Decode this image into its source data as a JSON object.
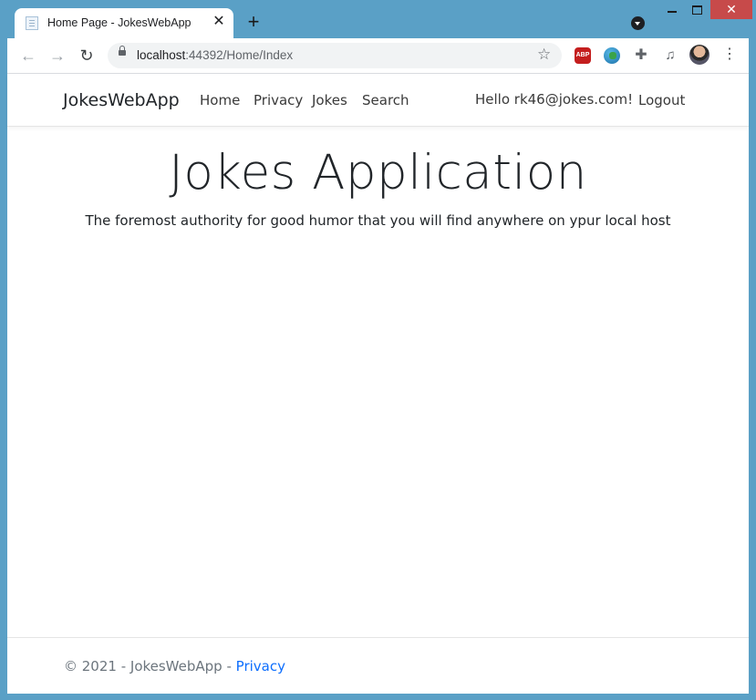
{
  "browser": {
    "tab_title": "Home Page - JokesWebApp",
    "url_host": "localhost",
    "url_path": ":44392/Home/Index"
  },
  "site": {
    "brand": "JokesWebApp",
    "nav": {
      "home": "Home",
      "privacy": "Privacy",
      "jokes": "Jokes",
      "search": "Search"
    },
    "hello": "Hello rk46@jokes.com!",
    "logout": "Logout"
  },
  "hero": {
    "title": "Jokes Application",
    "subtitle": "The foremost authority for good humor that you will find anywhere on ypur local host"
  },
  "footer": {
    "text": "© 2021 - JokesWebApp - ",
    "privacy_link": "Privacy"
  },
  "icons": {
    "abp_label": "ABP"
  },
  "colors": {
    "window_frame": "#5aa0c6",
    "link": "#0d6efd",
    "close_button": "#c74a4a"
  }
}
